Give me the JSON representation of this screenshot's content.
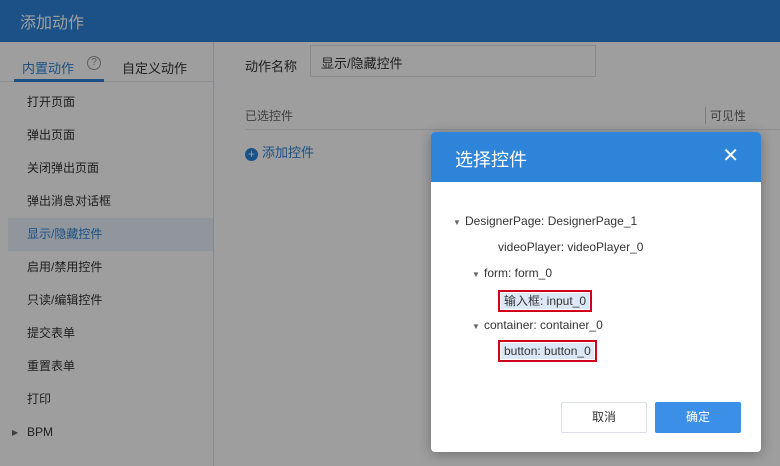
{
  "header": {
    "title": "添加动作"
  },
  "sidebar": {
    "tabs": [
      {
        "label": "内置动作"
      },
      {
        "label": "自定义动作"
      }
    ],
    "help_icon_glyph": "?",
    "items": [
      {
        "label": "打开页面"
      },
      {
        "label": "弹出页面"
      },
      {
        "label": "关闭弹出页面"
      },
      {
        "label": "弹出消息对话框"
      },
      {
        "label": "显示/隐藏控件"
      },
      {
        "label": "启用/禁用控件"
      },
      {
        "label": "只读/编辑控件"
      },
      {
        "label": "提交表单"
      },
      {
        "label": "重置表单"
      },
      {
        "label": "打印"
      },
      {
        "label": "BPM"
      }
    ],
    "active_index": 4
  },
  "main": {
    "name_label": "动作名称",
    "name_value": "显示/隐藏控件",
    "table_headers": [
      "已选控件",
      "可见性"
    ],
    "add_control_label": "添加控件",
    "add_icon_glyph": "+"
  },
  "dialog": {
    "title": "选择控件",
    "close_glyph": "✕",
    "tree": [
      {
        "label": "DesignerPage: DesignerPage_1",
        "expanded": true
      },
      {
        "label": "videoPlayer: videoPlayer_0"
      },
      {
        "label": "form: form_0",
        "expanded": true
      },
      {
        "label": "输入框: input_0",
        "highlighted": true
      },
      {
        "label": "container: container_0",
        "expanded": true
      },
      {
        "label": "button: button_0",
        "highlighted": true
      }
    ],
    "expand_glyph": "▼",
    "cancel_label": "取消",
    "ok_label": "确定"
  },
  "colors": {
    "primary": "#2d84d8",
    "highlight_border": "#d0021b"
  }
}
